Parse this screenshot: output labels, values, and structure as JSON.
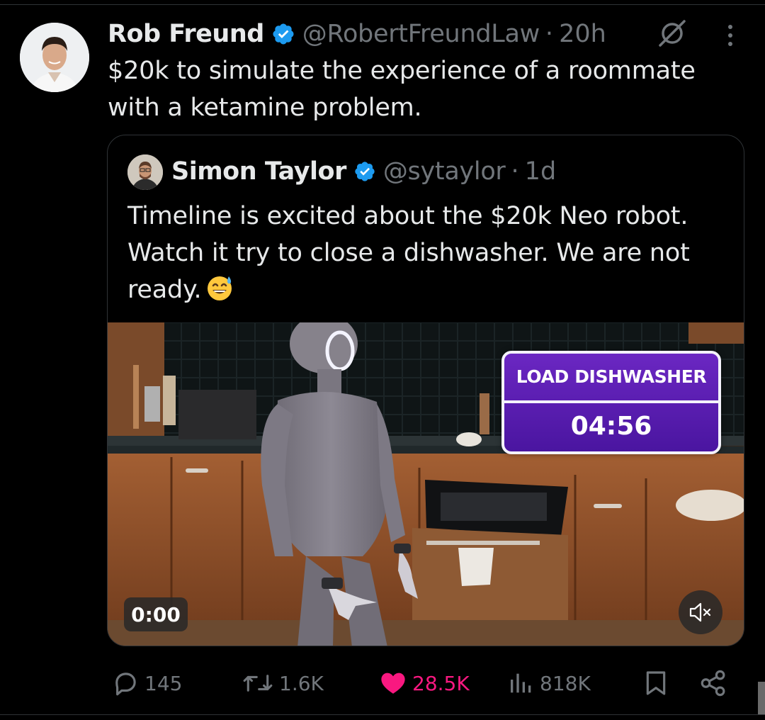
{
  "tweet": {
    "author_name": "Rob Freund",
    "author_handle": "@RobertFreundLaw",
    "separator": "·",
    "time": "20h",
    "text": "$20k to simulate the experience of a roommate with a ketamine problem."
  },
  "quoted_tweet": {
    "author_name": "Simon Taylor",
    "author_handle": "@sytaylor",
    "separator": "·",
    "time": "1d",
    "text": "Timeline is excited about the $20k Neo robot. Watch it try to close a dishwasher. We are not ready.",
    "emoji_icon": "grinning-face-with-sweat-icon"
  },
  "video": {
    "overlay_label": "LOAD DISHWASHER",
    "overlay_timer": "04:56",
    "timecode": "0:00",
    "overlay_color": "#5a1db3"
  },
  "actions": {
    "replies": "145",
    "reposts": "1.6K",
    "likes": "28.5K",
    "views": "818K"
  },
  "colors": {
    "background": "#000000",
    "text": "#e7e9ea",
    "muted": "#71767b",
    "verified": "#1d9bf0",
    "like": "#f91880",
    "border": "#2f3336"
  }
}
